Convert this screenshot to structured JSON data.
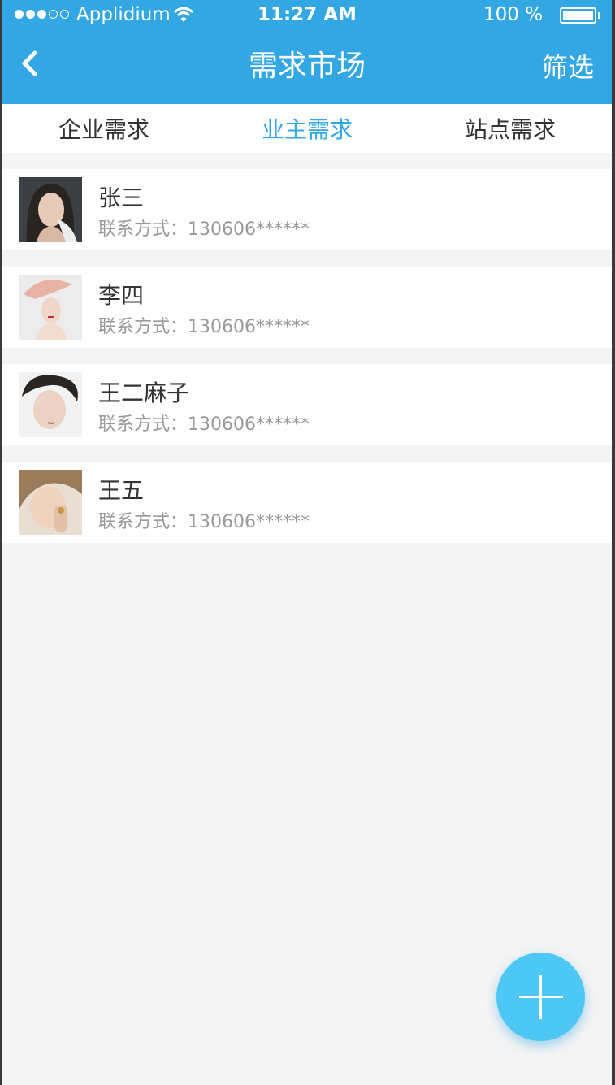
{
  "status_bar": {
    "carrier": "Applidium",
    "time": "11:27 AM",
    "battery": "100 %"
  },
  "nav": {
    "title": "需求市场",
    "filter_label": "筛选"
  },
  "tabs": [
    {
      "label": "企业需求"
    },
    {
      "label": "业主需求"
    },
    {
      "label": "站点需求"
    }
  ],
  "list": [
    {
      "name": "张三",
      "contact": "联系方式：130606******"
    },
    {
      "name": "李四",
      "contact": "联系方式：130606******"
    },
    {
      "name": "王二麻子",
      "contact": "联系方式：130606******"
    },
    {
      "name": "王五",
      "contact": "联系方式：130606******"
    }
  ],
  "colors": {
    "primary": "#32a7e3",
    "fab": "#4dc8f5",
    "text": "#333333",
    "subtext": "#999999",
    "background": "#f4f4f4"
  },
  "icons": {
    "back": "chevron-left-icon",
    "fab": "plus-icon"
  }
}
